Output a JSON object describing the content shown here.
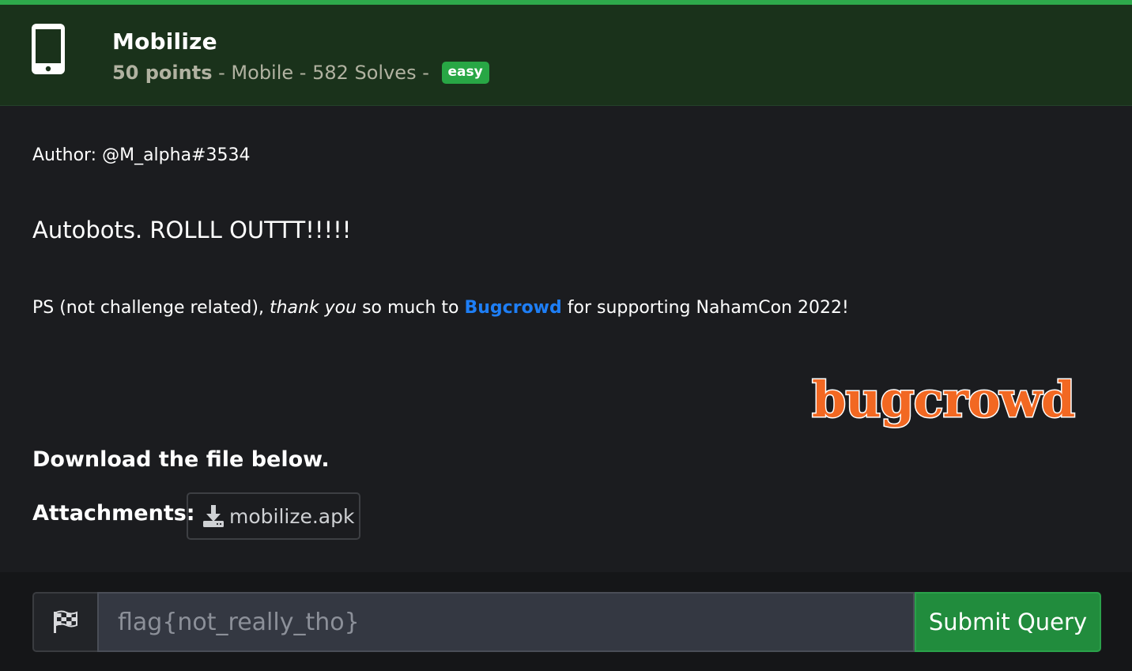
{
  "colors": {
    "accent_green": "#2ea94b",
    "header_bg": "#1a321b",
    "page_bg": "#1b1c1f",
    "link_blue": "#1e7ef5",
    "bugcrowd_orange": "#f26822",
    "badge_green": "#28a745",
    "submit_green": "#218c3d"
  },
  "header": {
    "icon": "mobile-phone-icon",
    "title": "Mobilize",
    "points": "50 points",
    "sep1": " - ",
    "category": "Mobile",
    "sep2": " - ",
    "solves": "582 Solves",
    "sep3": " - ",
    "difficulty": "easy"
  },
  "description": {
    "author": "Author: @M_alpha#3534",
    "tagline": "Autobots. ROLLL OUTTT!!!!!",
    "ps_prefix": "PS (not challenge related), ",
    "ps_emphasis": "thank you",
    "ps_middle": " so much to ",
    "ps_link": "Bugcrowd",
    "ps_suffix": " for supporting NahamCon 2022!",
    "logo_text": "bugcrowd",
    "download_heading": "Download the file below."
  },
  "attachments": {
    "label": "Attachments:",
    "file_icon": "download-icon",
    "file_name": "mobilize.apk"
  },
  "flag_form": {
    "addon_icon": "checkered-flag-icon",
    "placeholder": "flag{not_really_tho}",
    "value": "",
    "submit_label": "Submit Query"
  }
}
